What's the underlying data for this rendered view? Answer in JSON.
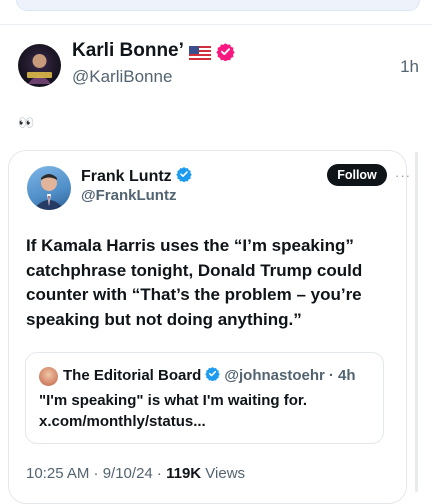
{
  "post": {
    "author_name": "Karli Bonne’",
    "author_handle": "@KarliBonne",
    "time_ago": "1h",
    "text": "👀"
  },
  "quoted_post": {
    "author_name": "Frank Luntz",
    "author_handle": "@FrankLuntz",
    "follow_label": "Follow",
    "more_label": "···",
    "text": "If Kamala Harris uses the “I’m speaking” catchphrase tonight, Donald Trump could counter with “That’s the problem – you’re speaking but not doing anything.”",
    "timestamp": "10:25 AM · 9/10/24 · ",
    "views_count": "119K",
    "views_label": " Views"
  },
  "nested_quote": {
    "author_name": "The Editorial Board",
    "author_handle": "@johnastoehr",
    "time_ago": "· 4h",
    "text": "\"I'm speaking\" is what I'm waiting for. x.com/monthly/status..."
  },
  "colors": {
    "verified_blue": "#1d9bf0",
    "badge_pink": "#f91880",
    "text_primary": "#0f1419",
    "text_secondary": "#536471"
  }
}
